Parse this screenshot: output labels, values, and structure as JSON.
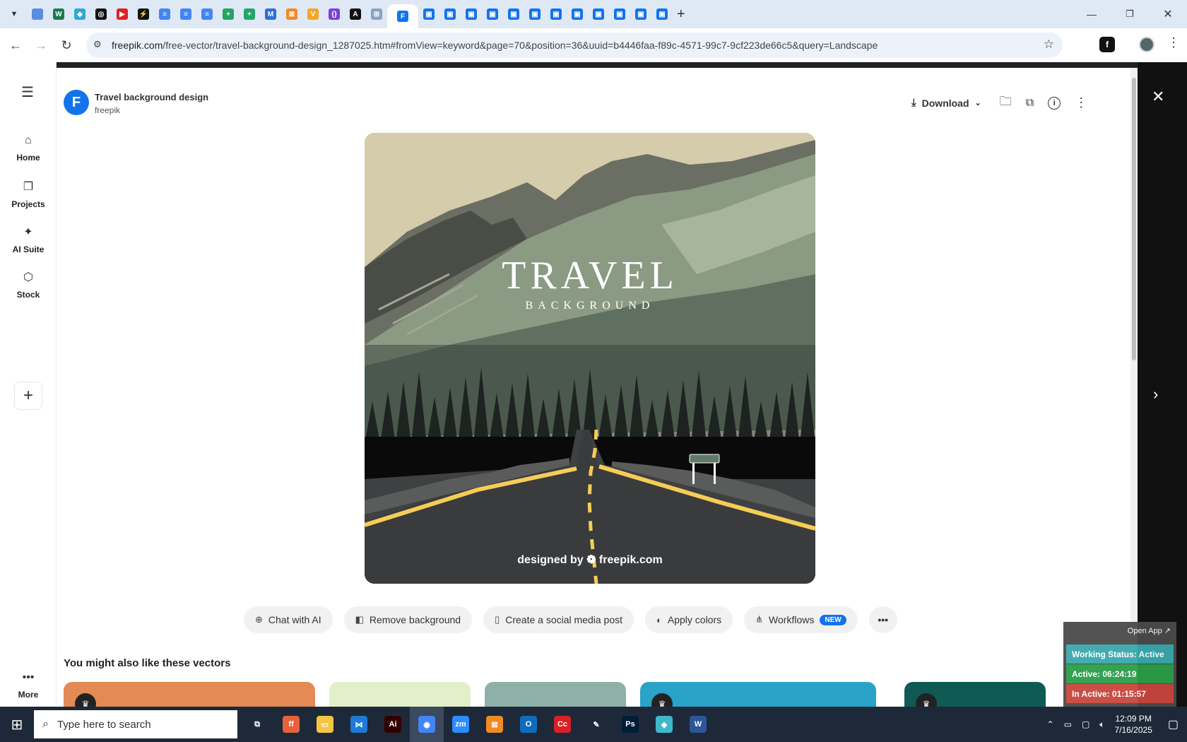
{
  "browser": {
    "url_host": "freepik.com",
    "url_path": "/free-vector/travel-background-design_1287025.htm#fromView=keyword&page=70&position=36&uuid=b4446faa-f89c-4571-99c7-9cf223de66c5&query=Landscape",
    "new_tab_label": "+",
    "tab_favicons": [
      {
        "color": "#5a8de0",
        "glyph": ""
      },
      {
        "color": "#1a7a4c",
        "glyph": "W"
      },
      {
        "color": "#2da8d8",
        "glyph": "◆"
      },
      {
        "color": "#111111",
        "glyph": "◎"
      },
      {
        "color": "#e02020",
        "glyph": "▶"
      },
      {
        "color": "#111111",
        "glyph": "⚡"
      },
      {
        "color": "#4285f4",
        "glyph": "≡"
      },
      {
        "color": "#4285f4",
        "glyph": "≡"
      },
      {
        "color": "#4285f4",
        "glyph": "≡"
      },
      {
        "color": "#23a566",
        "glyph": "+"
      },
      {
        "color": "#23a566",
        "glyph": "+"
      },
      {
        "color": "#2d6fd8",
        "glyph": "M"
      },
      {
        "color": "#f08a24",
        "glyph": "⊠"
      },
      {
        "color": "#f5a623",
        "glyph": "V"
      },
      {
        "color": "#7a3fd8",
        "glyph": "{}"
      },
      {
        "color": "#111111",
        "glyph": "A"
      },
      {
        "color": "#8aa0c8",
        "glyph": "⊞"
      },
      {
        "color": "#1273eb",
        "glyph": "F"
      }
    ]
  },
  "sidebar": {
    "items": [
      {
        "label": "Home",
        "icon": "home-icon",
        "glyph": "⌂"
      },
      {
        "label": "Projects",
        "icon": "projects-icon",
        "glyph": "❐"
      },
      {
        "label": "AI Suite",
        "icon": "ai-suite-icon",
        "glyph": "✦"
      },
      {
        "label": "Stock",
        "icon": "stock-icon",
        "glyph": "⬡"
      }
    ],
    "add_glyph": "+",
    "more_label": "More",
    "more_glyph": "•••"
  },
  "resource": {
    "logo_letter": "F",
    "title": "Travel background design",
    "author": "freepik"
  },
  "toolbar": {
    "download_label": "Download"
  },
  "artwork": {
    "title": "TRAVEL",
    "subtitle": "BACKGROUND",
    "credit": "designed by ❁ freepik.com"
  },
  "actions": [
    {
      "label": "Chat with AI",
      "icon": "chat-ai-icon",
      "glyph": "⊕"
    },
    {
      "label": "Remove background",
      "icon": "remove-bg-icon",
      "glyph": "◧"
    },
    {
      "label": "Create a social media post",
      "icon": "phone-icon",
      "glyph": "▯"
    },
    {
      "label": "Apply colors",
      "icon": "palette-icon",
      "glyph": "◐"
    },
    {
      "label": "Workflows",
      "icon": "workflows-icon",
      "glyph": "⋔",
      "badge": "NEW"
    }
  ],
  "related": {
    "title": "You might also like these vectors",
    "thumbs": [
      {
        "color": "#e38a55"
      },
      {
        "color": "#e3efc9"
      },
      {
        "color": "#8fb0a8"
      },
      {
        "color": "#29a3c7"
      },
      {
        "color": "#0f5a55"
      }
    ]
  },
  "widget": {
    "open_app": "Open App ↗",
    "working_status": "Working Status: Active",
    "active": "Active: 06:24:19",
    "inactive": "In Active: 01:15:57",
    "colors": {
      "status": "#3aa8ad",
      "active": "#2a9e48",
      "inactive": "#c9463d"
    }
  },
  "taskbar": {
    "search_placeholder": "Type here to search",
    "time": "12:09 PM",
    "date": "7/16/2025",
    "apps": [
      {
        "name": "task-view",
        "color": "#1d2939",
        "glyph": "⧉"
      },
      {
        "name": "firefox",
        "color": "#e8603c",
        "glyph": "ff"
      },
      {
        "name": "file-explorer",
        "color": "#f5c542",
        "glyph": "▭"
      },
      {
        "name": "vscode",
        "color": "#1e7ad6",
        "glyph": "⋈"
      },
      {
        "name": "illustrator",
        "color": "#330000",
        "glyph": "Ai"
      },
      {
        "name": "chrome",
        "color": "#4285f4",
        "glyph": "◉"
      },
      {
        "name": "zoom",
        "color": "#2d8cff",
        "glyph": "zm"
      },
      {
        "name": "xampp",
        "color": "#f08a24",
        "glyph": "⊠"
      },
      {
        "name": "outlook",
        "color": "#0f6cbd",
        "glyph": "O"
      },
      {
        "name": "creative-cloud",
        "color": "#da1f26",
        "glyph": "Cc"
      },
      {
        "name": "pen-tool",
        "color": "#1d2939",
        "glyph": "✎"
      },
      {
        "name": "photoshop",
        "color": "#001e36",
        "glyph": "Ps"
      },
      {
        "name": "app-gem",
        "color": "#3fb8c9",
        "glyph": "◆"
      },
      {
        "name": "word",
        "color": "#2b579a",
        "glyph": "W"
      }
    ]
  }
}
